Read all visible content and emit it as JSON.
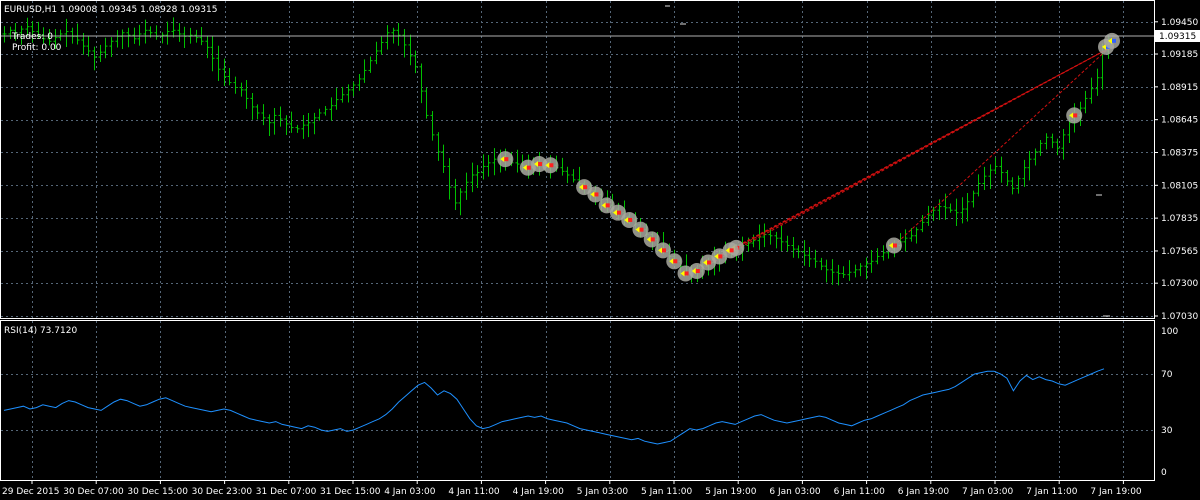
{
  "window": {
    "symbol_header": "EURUSD,H1  1.09008 1.09345 1.08928 1.09315",
    "trades_text": "Trades: 0",
    "profit_text": "Profit: 0.00"
  },
  "price_panel": {
    "current_price_label": "1.09315",
    "y_ticks": [
      "1.09450",
      "1.09185",
      "1.08915",
      "1.08645",
      "1.08375",
      "1.08105",
      "1.07835",
      "1.07565",
      "1.07300",
      "1.07030"
    ]
  },
  "rsi_panel": {
    "title": "RSI(14) 73.7120",
    "y_ticks": [
      "100",
      "70",
      "30",
      "0"
    ]
  },
  "x_axis": {
    "labels": [
      "29 Dec 2015",
      "30 Dec 07:00",
      "30 Dec 15:00",
      "30 Dec 23:00",
      "31 Dec 07:00",
      "31 Dec 15:00",
      "4 Jan 03:00",
      "4 Jan 11:00",
      "4 Jan 19:00",
      "5 Jan 03:00",
      "5 Jan 11:00",
      "5 Jan 19:00",
      "6 Jan 03:00",
      "6 Jan 11:00",
      "6 Jan 19:00",
      "7 Jan 03:00",
      "7 Jan 11:00",
      "7 Jan 19:00"
    ]
  },
  "colors": {
    "background": "#000000",
    "bar_color": "#00c000",
    "grid_color": "#556677",
    "rsi_line": "#1e90ff",
    "trade_line": "#d01010",
    "marker_halo": "#a8a8a0",
    "current_price_line": "#b0b0b0"
  },
  "chart_data": [
    {
      "type": "ohlc",
      "title": "EURUSD,H1",
      "ylim": [
        1.0703,
        1.0958
      ],
      "close_series_approx": [
        1.0935,
        1.0938,
        1.0936,
        1.0939,
        1.0941,
        1.0937,
        1.0934,
        1.0931,
        1.0929,
        1.0932,
        1.0935,
        1.0937,
        1.0933,
        1.093,
        1.0925,
        1.0921,
        1.0916,
        1.092,
        1.0925,
        1.0929,
        1.0933,
        1.0936,
        1.0934,
        1.0931,
        1.0935,
        1.0938,
        1.0936,
        1.0933,
        1.0934,
        1.0937,
        1.0938,
        1.0935,
        1.0933,
        1.0934,
        1.0932,
        1.0929,
        1.0924,
        1.0915,
        1.0906,
        1.09,
        1.0895,
        1.0891,
        1.0889,
        1.0882,
        1.0875,
        1.087,
        1.0866,
        1.0862,
        1.0868,
        1.0865,
        1.0861,
        1.0858,
        1.0857,
        1.086,
        1.0862,
        1.0866,
        1.087,
        1.0873,
        1.0876,
        1.0881,
        1.0885,
        1.0889,
        1.0893,
        1.0898,
        1.0905,
        1.0913,
        1.0921,
        1.0928,
        1.0936,
        1.0938,
        1.0934,
        1.0926,
        1.0917,
        1.0908,
        1.0888,
        1.0868,
        1.0852,
        1.0838,
        1.0826,
        1.0809,
        1.0796,
        1.0805,
        1.0813,
        1.0819,
        1.0821,
        1.0826,
        1.0829,
        1.0832,
        1.0833,
        1.0832,
        1.0829,
        1.0828,
        1.0827,
        1.0825,
        1.0827,
        1.0828,
        1.0829,
        1.0827,
        1.0825,
        1.0822,
        1.0819,
        1.0815,
        1.0812,
        1.0809,
        1.0806,
        1.0803,
        1.0799,
        1.0794,
        1.0791,
        1.0788,
        1.0785,
        1.0782,
        1.0778,
        1.0774,
        1.077,
        1.0766,
        1.0762,
        1.0757,
        1.0752,
        1.0748,
        1.0744,
        1.0738,
        1.0735,
        1.074,
        1.0744,
        1.0747,
        1.075,
        1.0752,
        1.0755,
        1.0757,
        1.0759,
        1.0761,
        1.0763,
        1.0765,
        1.0768,
        1.077,
        1.0769,
        1.0767,
        1.0764,
        1.0761,
        1.0758,
        1.0756,
        1.0753,
        1.075,
        1.0748,
        1.0744,
        1.0741,
        1.0739,
        1.0738,
        1.0737,
        1.0739,
        1.0741,
        1.0744,
        1.0746,
        1.0748,
        1.0752,
        1.0755,
        1.0758,
        1.0761,
        1.0764,
        1.0767,
        1.0769,
        1.0774,
        1.078,
        1.0786,
        1.079,
        1.0793,
        1.0792,
        1.079,
        1.0788,
        1.0791,
        1.0797,
        1.0804,
        1.0812,
        1.0818,
        1.0823,
        1.0826,
        1.0821,
        1.0814,
        1.0808,
        1.0816,
        1.0825,
        1.0832,
        1.0838,
        1.0845,
        1.085,
        1.0846,
        1.0841,
        1.0852,
        1.0862,
        1.0868,
        1.0874,
        1.0882,
        1.089,
        1.0899,
        1.0921,
        1.0931
      ],
      "series": [
        {
          "name": "EURUSD,H1",
          "role": "price bars"
        }
      ]
    },
    {
      "type": "line",
      "title": "RSI(14) 73.7120",
      "ylim": [
        0,
        100
      ],
      "series": [
        {
          "name": "RSI(14)",
          "values": [
            44,
            45,
            46,
            47,
            45,
            46,
            48,
            47,
            46,
            49,
            51,
            50,
            48,
            46,
            45,
            44,
            47,
            50,
            52,
            51,
            49,
            47,
            48,
            50,
            52,
            53,
            51,
            49,
            47,
            46,
            45,
            44,
            43,
            44,
            45,
            44,
            42,
            40,
            38,
            37,
            36,
            35,
            36,
            34,
            33,
            32,
            31,
            33,
            32,
            30,
            29,
            30,
            31,
            29,
            30,
            32,
            34,
            36,
            38,
            41,
            45,
            50,
            54,
            58,
            62,
            64,
            60,
            55,
            58,
            56,
            52,
            45,
            38,
            33,
            31,
            32,
            34,
            36,
            37,
            38,
            39,
            40,
            39,
            40,
            38,
            37,
            36,
            35,
            33,
            31,
            30,
            29,
            28,
            27,
            26,
            25,
            24,
            23,
            24,
            22,
            21,
            20,
            21,
            22,
            25,
            28,
            31,
            30,
            31,
            33,
            35,
            36,
            35,
            34,
            36,
            38,
            40,
            41,
            39,
            37,
            36,
            35,
            36,
            37,
            38,
            39,
            40,
            39,
            37,
            35,
            34,
            33,
            35,
            37,
            38,
            40,
            42,
            44,
            46,
            48,
            51,
            53,
            55,
            56,
            57,
            58,
            59,
            61,
            64,
            67,
            70,
            71,
            72,
            72,
            70,
            67,
            58,
            65,
            69,
            66,
            68,
            66,
            65,
            63,
            62,
            64,
            66,
            68,
            70,
            72,
            73.7
          ]
        }
      ]
    }
  ]
}
